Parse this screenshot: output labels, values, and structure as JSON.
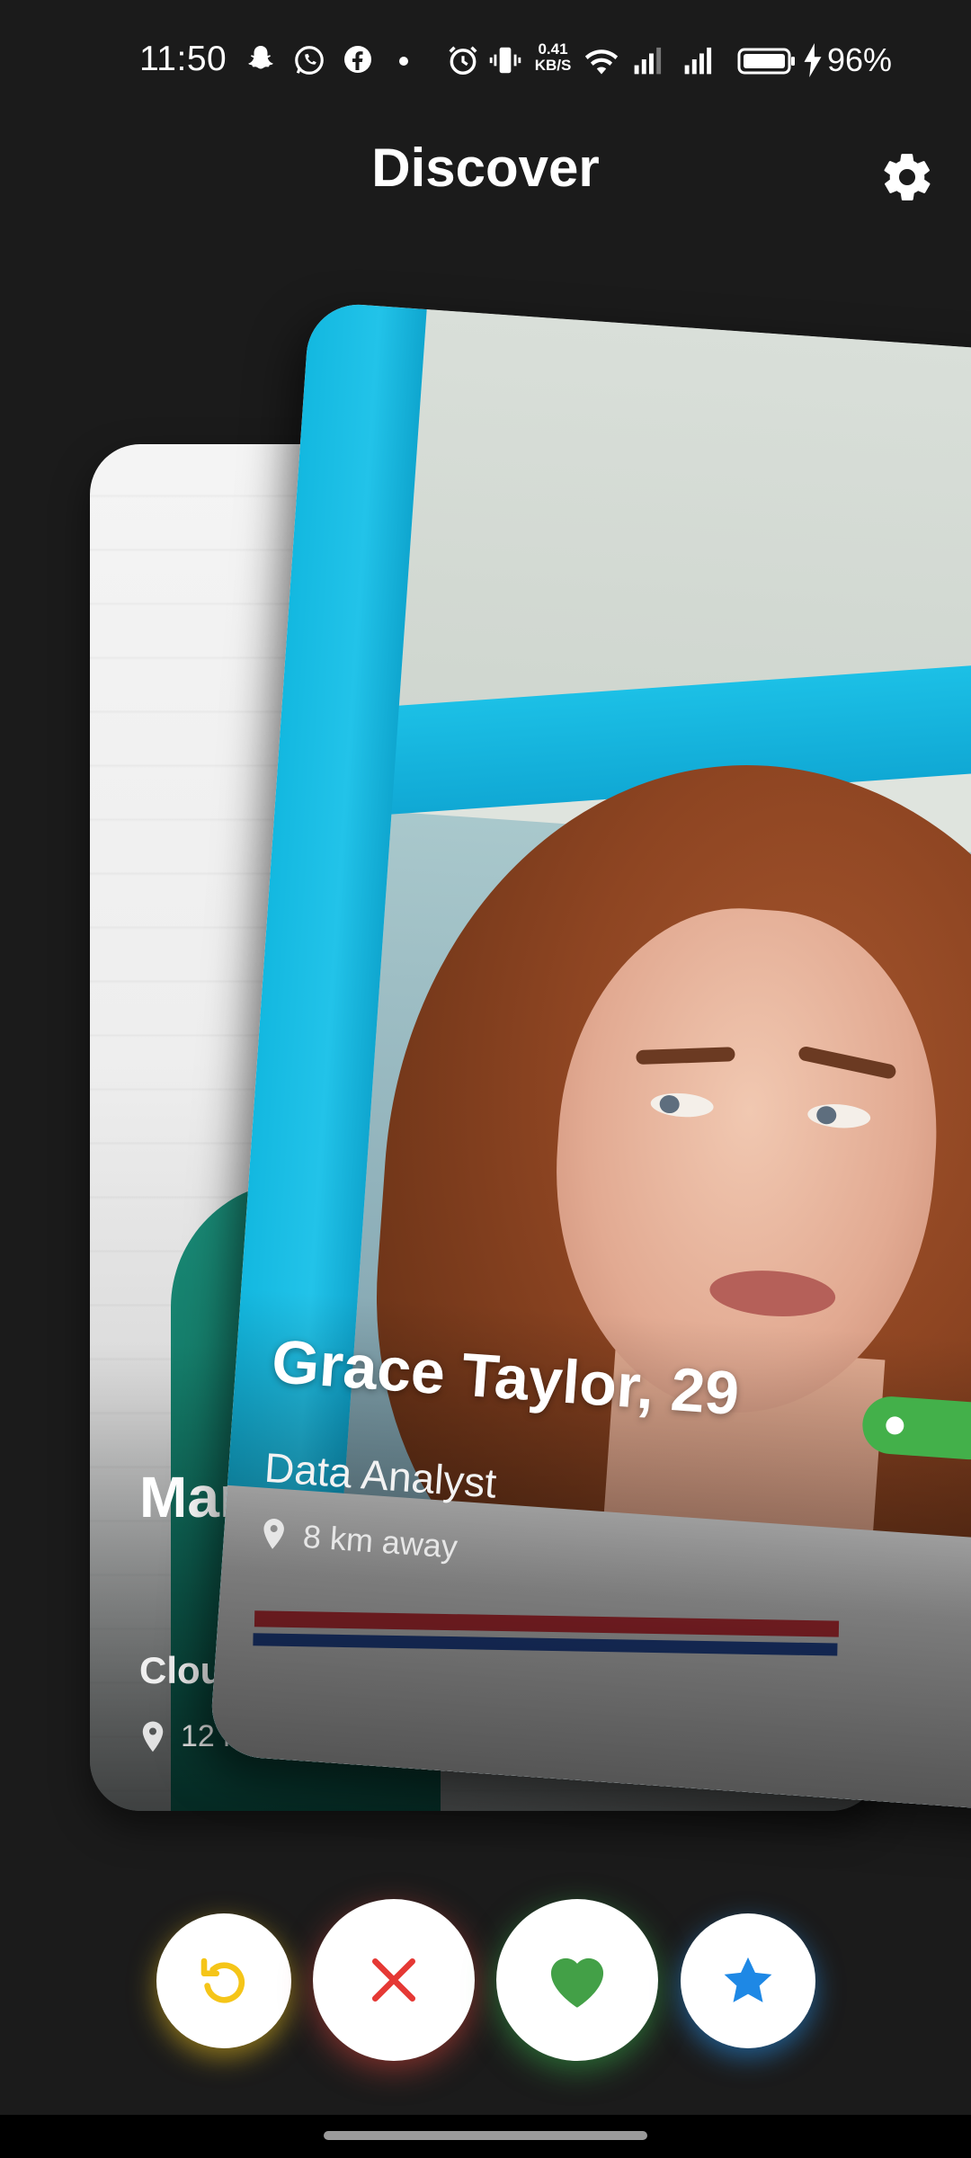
{
  "status_bar": {
    "time": "11:50",
    "net_speed": "0.41\nKB/S",
    "battery_percent": "96%",
    "icons": [
      "snapchat-icon",
      "whatsapp-icon",
      "facebook-icon",
      "dot-icon",
      "alarm-icon",
      "vibrate-icon",
      "wifi-icon",
      "signal-icon",
      "signal-icon",
      "battery-icon",
      "charging-icon"
    ]
  },
  "header": {
    "title": "Discover",
    "settings_icon": "gear-icon"
  },
  "cards": {
    "back": {
      "name_age": "Marc 33",
      "job": "Cloud A",
      "distance": "12 km"
    },
    "front": {
      "name_age": "Grace Taylor, 29",
      "job": "Data Analyst",
      "distance": "8 km away",
      "online_badge_color": "#43b04a"
    }
  },
  "actions": {
    "undo": {
      "icon": "undo-icon",
      "color": "#f5c518"
    },
    "dislike": {
      "icon": "close-icon",
      "color": "#e53935"
    },
    "like": {
      "icon": "heart-icon",
      "color": "#43a047"
    },
    "superlike": {
      "icon": "star-icon",
      "color": "#1e88e5"
    }
  }
}
